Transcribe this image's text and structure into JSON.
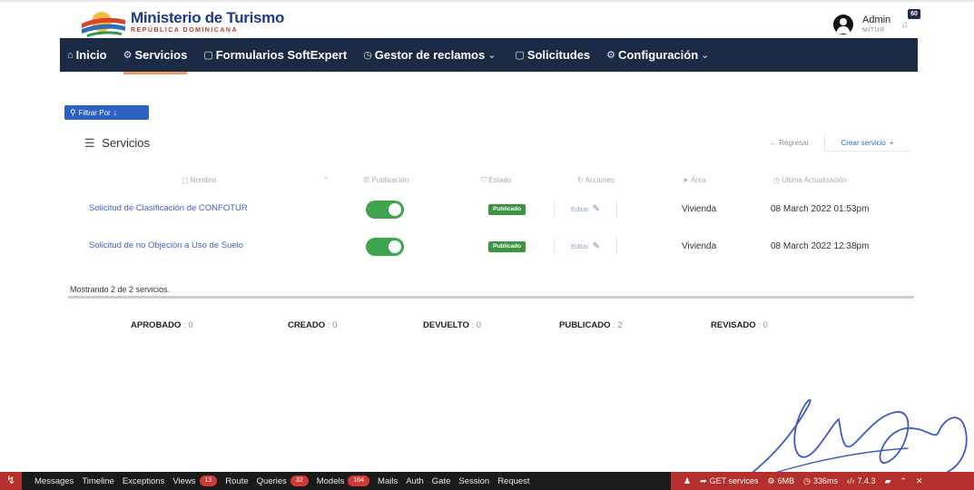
{
  "brand": {
    "title": "Ministerio de Turismo",
    "subtitle": "REPÚBLICA DOMINICANA"
  },
  "user": {
    "name": "Admin",
    "org": "MITUR",
    "notifications": "60"
  },
  "nav": [
    {
      "icon": "home-icon",
      "label": "Inicio"
    },
    {
      "icon": "services-icon",
      "label": "Servicios"
    },
    {
      "icon": "clipboard-icon",
      "label": "Formularios SoftExpert"
    },
    {
      "icon": "clock-icon",
      "label": "Gestor de reclamos"
    },
    {
      "icon": "clipboard-icon",
      "label": "Solicitudes"
    },
    {
      "icon": "gear-icon",
      "label": "Configuración"
    }
  ],
  "filter_label": "Filtrar Por",
  "section_title": "Servicios",
  "back_label": "Regresar",
  "create_label": "Crear servicio",
  "columns": [
    "Nombre",
    "Publicación",
    "Estado",
    "Acciones",
    "Área",
    "Última Actualización"
  ],
  "rows": [
    {
      "name": "Solicitud de Clasificación de CONFOTUR",
      "published": true,
      "status": "Publicado",
      "action": "Editar",
      "area": "Vivienda",
      "updated": "08 March 2022 01:53pm"
    },
    {
      "name": "Solicitud de no Objeción a Uso de Suelo",
      "published": true,
      "status": "Publicado",
      "action": "Editar",
      "area": "Vivienda",
      "updated": "08 March 2022 12:38pm"
    }
  ],
  "showing": "Mostrando 2 de 2 servicios.",
  "stats": [
    {
      "label": "APROBADO",
      "value": ": 0"
    },
    {
      "label": "CREADO",
      "value": ": 0"
    },
    {
      "label": "DEVUELTO",
      "value": ": 0"
    },
    {
      "label": "PUBLICADO",
      "value": ": 2"
    },
    {
      "label": "REVISADO",
      "value": ": 0"
    }
  ],
  "debugbar": {
    "tabs": [
      {
        "label": "Messages"
      },
      {
        "label": "Timeline"
      },
      {
        "label": "Exceptions"
      },
      {
        "label": "Views",
        "count": "13"
      },
      {
        "label": "Route"
      },
      {
        "label": "Queries",
        "count": "32"
      },
      {
        "label": "Models",
        "count": "164"
      },
      {
        "label": "Mails"
      },
      {
        "label": "Auth"
      },
      {
        "label": "Gate"
      },
      {
        "label": "Session"
      },
      {
        "label": "Request"
      }
    ],
    "request": "GET services",
    "memory": "6MB",
    "time": "336ms",
    "version": "7.4.3"
  },
  "colors": {
    "nav_bg": "#1c2b45",
    "accent": "#2d62c4",
    "toggle_on": "#3fa34d",
    "debug_red": "#b3302c"
  }
}
